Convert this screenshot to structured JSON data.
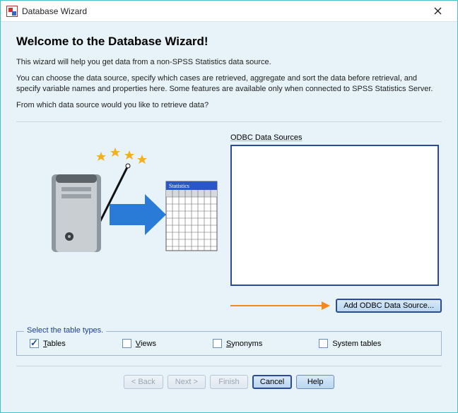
{
  "window": {
    "title": "Database Wizard"
  },
  "heading": "Welcome to the Database Wizard!",
  "intro1": "This wizard will help you get data from a non-SPSS Statistics data source.",
  "intro2": "You can choose the data source, specify which cases are retrieved, aggregate and sort the data before retrieval, and specify variable names and properties here. Some features are available only when connected to SPSS Statistics Server.",
  "prompt": "From which data source would you like to retrieve data?",
  "datasource": {
    "label": "ODBC Data Sources",
    "add_button": "Add ODBC Data Source..."
  },
  "illustration": {
    "table_header": "Statistics"
  },
  "types": {
    "legend": "Select the table types.",
    "tables": {
      "label_pre": "T",
      "label_rest": "ables",
      "checked": true
    },
    "views": {
      "label_pre": "V",
      "label_rest": "iews",
      "checked": false
    },
    "synonyms": {
      "label_pre": "S",
      "label_rest": "ynonyms",
      "checked": false
    },
    "system": {
      "label_pre": "",
      "label_rest": "System tables",
      "checked": false
    }
  },
  "footer": {
    "back": "< Back",
    "next": "Next >",
    "finish": "Finish",
    "cancel": "Cancel",
    "help": "Help"
  }
}
